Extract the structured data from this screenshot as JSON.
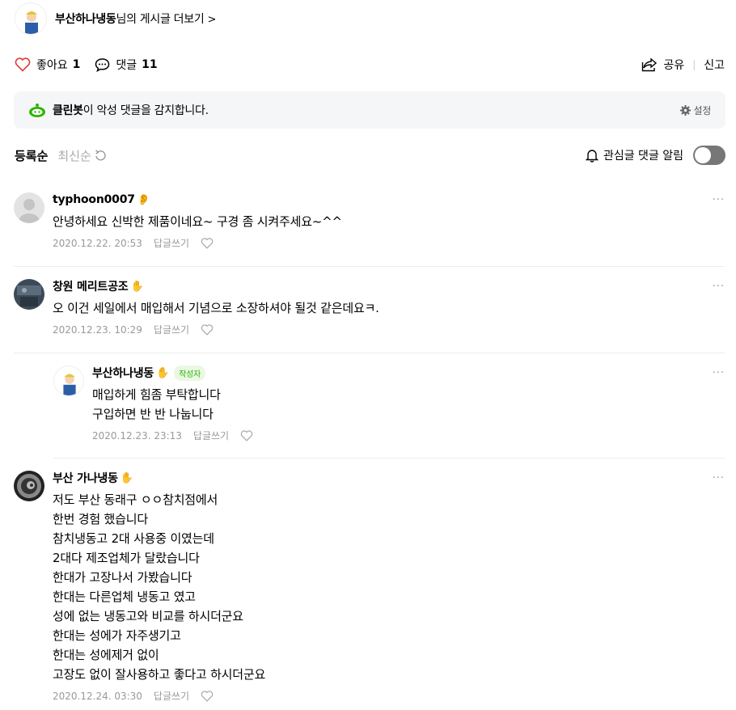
{
  "author": {
    "name": "부산하나냉동",
    "suffix": "님의 게시글 더보기",
    "chevron": ">"
  },
  "actions": {
    "like_label": "좋아요",
    "like_count": "1",
    "comment_label": "댓글",
    "comment_count": "11",
    "share_label": "공유",
    "separator": "|",
    "report_label": "신고"
  },
  "cleanbot": {
    "name": "클린봇",
    "message": "이 악성 댓글을 감지합니다.",
    "settings_label": "설정"
  },
  "sort": {
    "active": "등록순",
    "inactive": "최신순",
    "notify_label": "관심글 댓글 알림"
  },
  "comments": [
    {
      "nick": "typhoon0007",
      "text": "안녕하세요 신박한 제품이네요~ 구경 좀 시켜주세요~^^",
      "date": "2020.12.22. 20:53",
      "reply": "답글쓰기"
    },
    {
      "nick": "창원 메리트공조",
      "text": "오 이건 세일에서 매입해서 기념으로 소장하셔야 될것 같은데요ㅋ.",
      "date": "2020.12.23. 10:29",
      "reply": "답글쓰기"
    },
    {
      "nick": "부산하나냉동",
      "badge": "작성자",
      "text": "매입하게 힘좀 부탁합니다\n구입하면 반 반 나눕니다",
      "date": "2020.12.23. 23:13",
      "reply": "답글쓰기"
    },
    {
      "nick": "부산 가나냉동",
      "text": "저도 부산 동래구 ㅇㅇ참치점에서\n한번 경험 했습니다\n참치냉동고 2대 사용중 이였는데\n2대다 제조업체가 달랐습니다\n한대가 고장나서 가봤습니다\n한대는 다른업체 냉동고 였고\n성에 없는 냉동고와 비교를 하시더군요\n한대는 성에가 자주생기고\n한대는 성에제거 없이\n고장도 없이 잘사용하고 좋다고 하시더군요",
      "date": "2020.12.24. 03:30",
      "reply": "답글쓰기"
    }
  ],
  "more_label": "···",
  "colors": {
    "accent_green": "#2db400",
    "cleanbot_bg": "#f5f6f8",
    "toggle_off": "#777777"
  },
  "icons": [
    "heart-icon",
    "comment-icon",
    "share-icon",
    "cleanbot-icon",
    "gear-icon",
    "refresh-icon",
    "bell-icon",
    "hand-icon",
    "more-icon"
  ]
}
